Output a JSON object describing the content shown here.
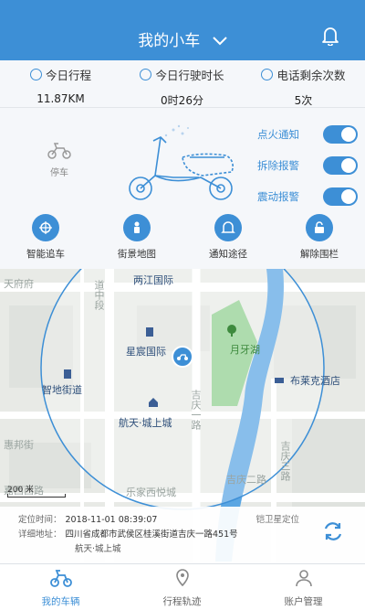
{
  "header": {
    "title": "我的小车"
  },
  "stats": [
    {
      "label": "今日行程",
      "value": "11.87KM"
    },
    {
      "label": "今日行驶时长",
      "value": "0时26分"
    },
    {
      "label": "电话剩余次数",
      "value": "5次"
    }
  ],
  "vehicle": {
    "status_label": "停车"
  },
  "toggles": [
    {
      "label": "点火通知",
      "on": true
    },
    {
      "label": "拆除报警",
      "on": true
    },
    {
      "label": "震动报警",
      "on": true
    }
  ],
  "actions": [
    {
      "label": "智能追车",
      "icon": "locate-icon"
    },
    {
      "label": "街景地图",
      "icon": "street-view-icon"
    },
    {
      "label": "通知途径",
      "icon": "bell-icon"
    },
    {
      "label": "解除围栏",
      "icon": "unlock-icon"
    }
  ],
  "map": {
    "pois": {
      "tianfu": "天府府",
      "xiangzhong": "道中段",
      "liangjiang": "两江国际",
      "xingchen": "星宸国际",
      "zhidi": "智地街道",
      "yueyahu": "月牙湖",
      "bulaike": "布莱克酒店",
      "hangtian": "航天·城上城",
      "jiqing": "吉庆一路",
      "jiqing3": "吉庆三路",
      "huibang": "惠邦街",
      "jiaxixi": "嘉西西路",
      "lejia": "乐家西悦城",
      "jixi": "吉庆二路",
      "jiqing4": "吉庆西路"
    },
    "scale_label": "200 米"
  },
  "location": {
    "time_label": "定位时间：",
    "time_value": "2018-11-01 08:39:07",
    "source": "铠卫星定位",
    "address_label": "详细地址：",
    "address_value": "四川省成都市武侯区桂溪街道吉庆一路451号",
    "address_line2": "航天·城上城"
  },
  "tabs": [
    {
      "label": "我的车辆",
      "active": true
    },
    {
      "label": "行程轨迹",
      "active": false
    },
    {
      "label": "账户管理",
      "active": false
    }
  ],
  "colors": {
    "primary": "#3d8fd6",
    "water": "#5aa6e3",
    "park": "#8fcf8f"
  }
}
